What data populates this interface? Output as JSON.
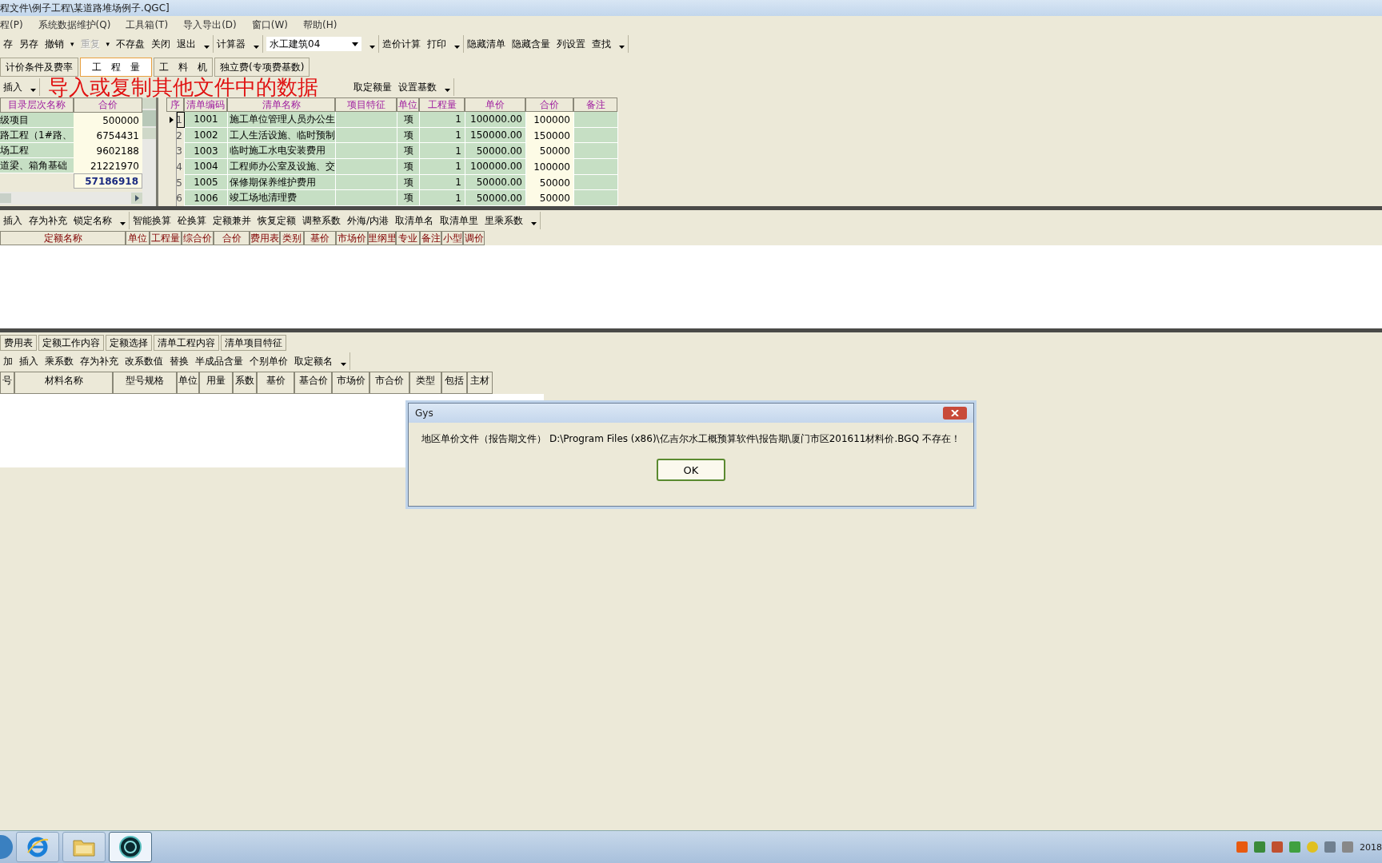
{
  "window": {
    "title": "程文件\\例子工程\\某道路堆场例子.QGC]"
  },
  "menu": [
    "程(P)",
    "系统数据维护(Q)",
    "工具箱(T)",
    "导入导出(D)",
    "窗口(W)",
    "帮助(H)"
  ],
  "toolbar": [
    [
      {
        "kind": "button",
        "label": "存",
        "disabled": false
      },
      {
        "kind": "button",
        "label": "另存",
        "disabled": false
      },
      {
        "kind": "button",
        "label": "撤销",
        "disabled": false
      },
      {
        "kind": "caret",
        "label": "▾"
      },
      {
        "kind": "button",
        "label": "重复",
        "disabled": true
      },
      {
        "kind": "caret",
        "label": "▾"
      },
      {
        "kind": "button",
        "label": "不存盘",
        "disabled": false
      },
      {
        "kind": "button",
        "label": "关闭",
        "disabled": false
      },
      {
        "kind": "button",
        "label": "退出",
        "disabled": false
      }
    ],
    [
      {
        "kind": "button",
        "label": "计算器",
        "disabled": false
      }
    ],
    [
      {
        "kind": "combo",
        "label": "水工建筑04"
      }
    ],
    [
      {
        "kind": "button",
        "label": "造价计算",
        "disabled": false
      },
      {
        "kind": "button",
        "label": "打印",
        "disabled": false
      }
    ],
    [
      {
        "kind": "button",
        "label": "隐藏清单",
        "disabled": false
      },
      {
        "kind": "button",
        "label": "隐藏含量",
        "disabled": false
      },
      {
        "kind": "button",
        "label": "列设置",
        "disabled": false
      },
      {
        "kind": "button",
        "label": "查找",
        "disabled": false
      }
    ]
  ],
  "tabs": [
    {
      "label": "计价条件及费率",
      "selected": false
    },
    {
      "label": "工　程　量",
      "selected": true
    },
    {
      "label": "工　料　机",
      "selected": false
    },
    {
      "label": "独立费(专项费基数)",
      "selected": false
    }
  ],
  "list_toolbar": [
    [
      "插入"
    ],
    [
      "取定额量",
      "设置基数"
    ]
  ],
  "overlay_caption": "导入或复制其他文件中的数据",
  "tree_table": {
    "columns": [
      "目录层次名称",
      "合价"
    ],
    "rows": [
      {
        "name": "级项目",
        "total": "500000"
      },
      {
        "name": "路工程（1#路、",
        "total": "6754431"
      },
      {
        "name": "场工程",
        "total": "9602188"
      },
      {
        "name": "道梁、箱角基础",
        "total": "21221970"
      }
    ],
    "sum": "57186918"
  },
  "bill_table": {
    "columns": [
      "序",
      "清单编码",
      "清单名称",
      "项目特征",
      "单位",
      "工程量",
      "单价",
      "合价",
      "备注"
    ],
    "rows": [
      {
        "seq": "1",
        "code": "1001",
        "name": "施工单位管理人员办公生",
        "unit": "项",
        "qty": "1",
        "price": "100000.00",
        "total": "100000",
        "selected": true
      },
      {
        "seq": "2",
        "code": "1002",
        "name": "工人生活设施、临时预制",
        "unit": "项",
        "qty": "1",
        "price": "150000.00",
        "total": "150000",
        "selected": false
      },
      {
        "seq": "3",
        "code": "1003",
        "name": "临时施工水电安装费用",
        "unit": "项",
        "qty": "1",
        "price": "50000.00",
        "total": "50000",
        "selected": false
      },
      {
        "seq": "4",
        "code": "1004",
        "name": "工程师办公室及设施、交",
        "unit": "项",
        "qty": "1",
        "price": "100000.00",
        "total": "100000",
        "selected": false
      },
      {
        "seq": "5",
        "code": "1005",
        "name": "保修期保养维护费用",
        "unit": "项",
        "qty": "1",
        "price": "50000.00",
        "total": "50000",
        "selected": false
      },
      {
        "seq": "6",
        "code": "1006",
        "name": "竣工场地清理费",
        "unit": "项",
        "qty": "1",
        "price": "50000.00",
        "total": "50000",
        "selected": false
      }
    ]
  },
  "quota_toolbar": [
    [
      "插入",
      "存为补充",
      "锁定名称"
    ],
    [
      "智能换算",
      "砼换算",
      "定额兼并",
      "恢复定额",
      "调整系数",
      "外海/内港",
      "取清单名",
      "取清单里",
      "里乘系数"
    ]
  ],
  "quota_table": {
    "columns": [
      "定额名称",
      "单位",
      "工程量",
      "综合价",
      "合价",
      "费用表",
      "类别",
      "基价",
      "市场价",
      "里纲里",
      "专业",
      "备注",
      "小型",
      "调价"
    ]
  },
  "detail_tabs": [
    {
      "label": "费用表",
      "selected": false
    },
    {
      "label": "定额工作内容",
      "selected": false
    },
    {
      "label": "定额选择",
      "selected": false
    },
    {
      "label": "清单工程内容",
      "selected": false
    },
    {
      "label": "清单项目特征",
      "selected": false
    }
  ],
  "material_toolbar": [
    "加",
    "插入",
    "乘系数",
    "存为补充",
    "改系数值",
    "替换",
    "半成品含量",
    "个别单价",
    "取定额名"
  ],
  "material_table": {
    "columns": [
      "号",
      "材料名称",
      "型号规格",
      "单位",
      "用量",
      "系数",
      "基价",
      "基合价",
      "市场价",
      "市合价",
      "类型",
      "包括",
      "主材"
    ]
  },
  "dialog": {
    "title": "Gys",
    "message": "地区单价文件（报告期文件） D:\\Program Files (x86)\\亿吉尔水工概预算软件\\报告期\\厦门市区201611材料价.BGQ 不存在！",
    "button": "OK"
  },
  "taskbar": {
    "apps": [
      {
        "kind": "browser",
        "selected": false
      },
      {
        "kind": "folder",
        "selected": false
      },
      {
        "kind": "sg",
        "selected": true
      }
    ],
    "clock": "2018"
  }
}
